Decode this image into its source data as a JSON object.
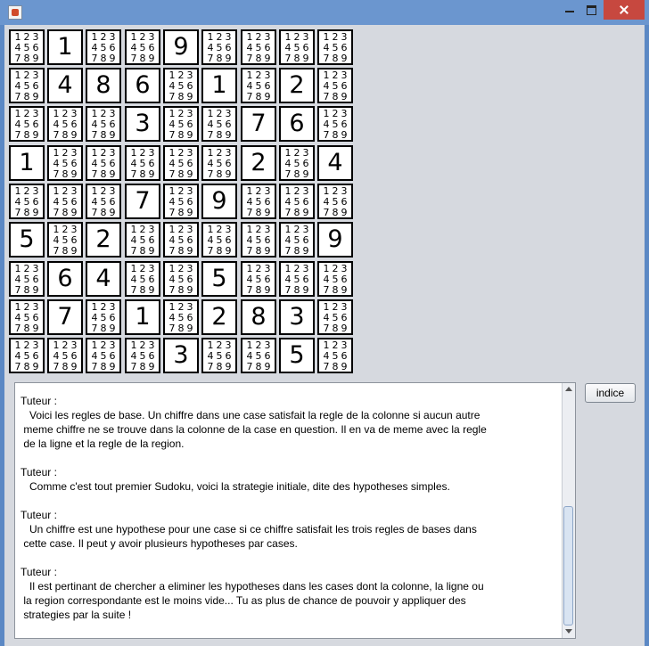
{
  "window": {
    "title": ""
  },
  "board": {
    "cells": [
      [
        0,
        1,
        0,
        0,
        9,
        0,
        0,
        0,
        0
      ],
      [
        0,
        4,
        8,
        6,
        0,
        1,
        0,
        2,
        0
      ],
      [
        0,
        0,
        0,
        3,
        0,
        0,
        7,
        6,
        0
      ],
      [
        1,
        0,
        0,
        0,
        0,
        0,
        2,
        0,
        4
      ],
      [
        0,
        0,
        0,
        7,
        0,
        9,
        0,
        0,
        0
      ],
      [
        5,
        0,
        2,
        0,
        0,
        0,
        0,
        0,
        9
      ],
      [
        0,
        6,
        4,
        0,
        0,
        5,
        0,
        0,
        0
      ],
      [
        0,
        7,
        0,
        1,
        0,
        2,
        8,
        3,
        0
      ],
      [
        0,
        0,
        0,
        0,
        3,
        0,
        0,
        5,
        0
      ]
    ],
    "hypotheses": [
      "1",
      "2",
      "3",
      "4",
      "5",
      "6",
      "7",
      "8",
      "9"
    ]
  },
  "tutor": {
    "entries": [
      {
        "label": "Tuteur :",
        "lines": [
          "   Voici les regles de base. Un chiffre dans une case satisfait la regle de la colonne si aucun autre",
          " meme chiffre ne se trouve dans la colonne de la case en question. Il en va de meme avec la regle",
          " de la ligne et la regle de la region."
        ]
      },
      {
        "label": "Tuteur :",
        "lines": [
          "   Comme c'est tout premier Sudoku, voici la strategie initiale, dite des hypotheses simples."
        ]
      },
      {
        "label": "Tuteur :",
        "lines": [
          "   Un chiffre est une hypothese pour une case si ce chiffre satisfait les trois regles de bases dans",
          " cette case. Il peut y avoir plusieurs hypotheses par cases."
        ]
      },
      {
        "label": "Tuteur :",
        "lines": [
          "   Il est pertinant de chercher a eliminer les hypotheses dans les cases dont la colonne, la ligne ou",
          " la region correspondante est le moins vide... Tu as plus de chance de pouvoir y appliquer des",
          " strategies par la suite !"
        ]
      }
    ]
  },
  "hint_button": {
    "label": "indice"
  }
}
